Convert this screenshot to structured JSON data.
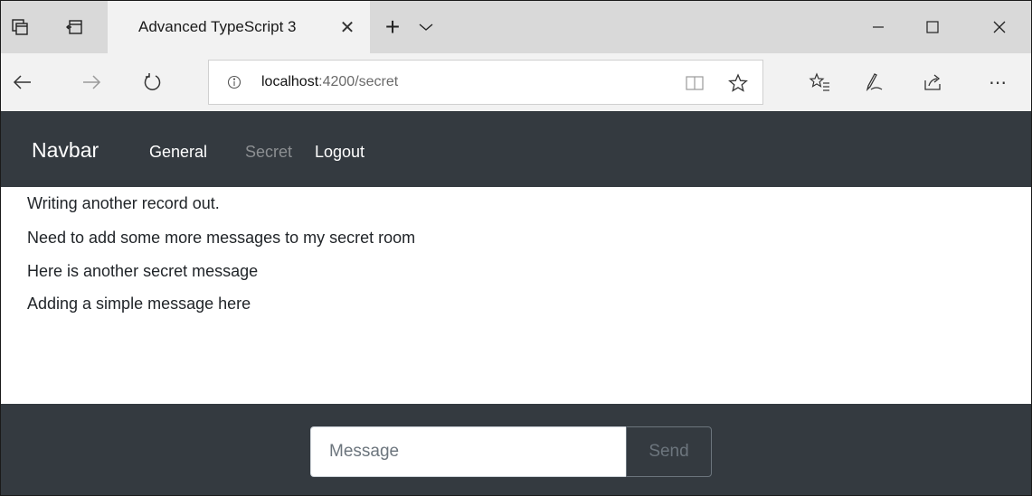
{
  "browser": {
    "tab": {
      "title": "Advanced TypeScript 3",
      "close_glyph": "✕"
    },
    "new_tab_glyph": "+",
    "tab_list_glyph": "⌄",
    "address": {
      "host": "localhost",
      "rest": ":4200/secret"
    },
    "icons": {
      "tab-preview": "tab-preview-icon",
      "set-aside": "set-aside-tabs-icon",
      "back": "back-arrow-icon",
      "forward": "forward-arrow-icon",
      "refresh": "refresh-icon",
      "info": "info-icon",
      "reading-view": "reading-view-icon",
      "favorite": "star-icon",
      "favorites-hub": "favorites-list-icon",
      "ink": "pen-icon",
      "share": "share-icon",
      "more": "more-icon"
    },
    "colors": {
      "tabbar_bg": "#d9d9d9",
      "active_tab_bg": "#f2f2f2",
      "toolbar_bg": "#f2f2f2"
    }
  },
  "app": {
    "navbar": {
      "brand": "Navbar",
      "links": [
        {
          "label": "General",
          "active": true
        },
        {
          "label": "Secret",
          "active": false
        },
        {
          "label": "Logout",
          "active": true
        }
      ]
    },
    "messages": [
      "Writing another record out.",
      "Need to add some more messages to my secret room",
      "Here is another secret message",
      "Adding a simple message here"
    ],
    "composer": {
      "placeholder": "Message",
      "value": "",
      "send_label": "Send"
    },
    "colors": {
      "navbar_bg": "#343a40",
      "text": "#212529",
      "muted_link": "#8c8f92"
    }
  }
}
